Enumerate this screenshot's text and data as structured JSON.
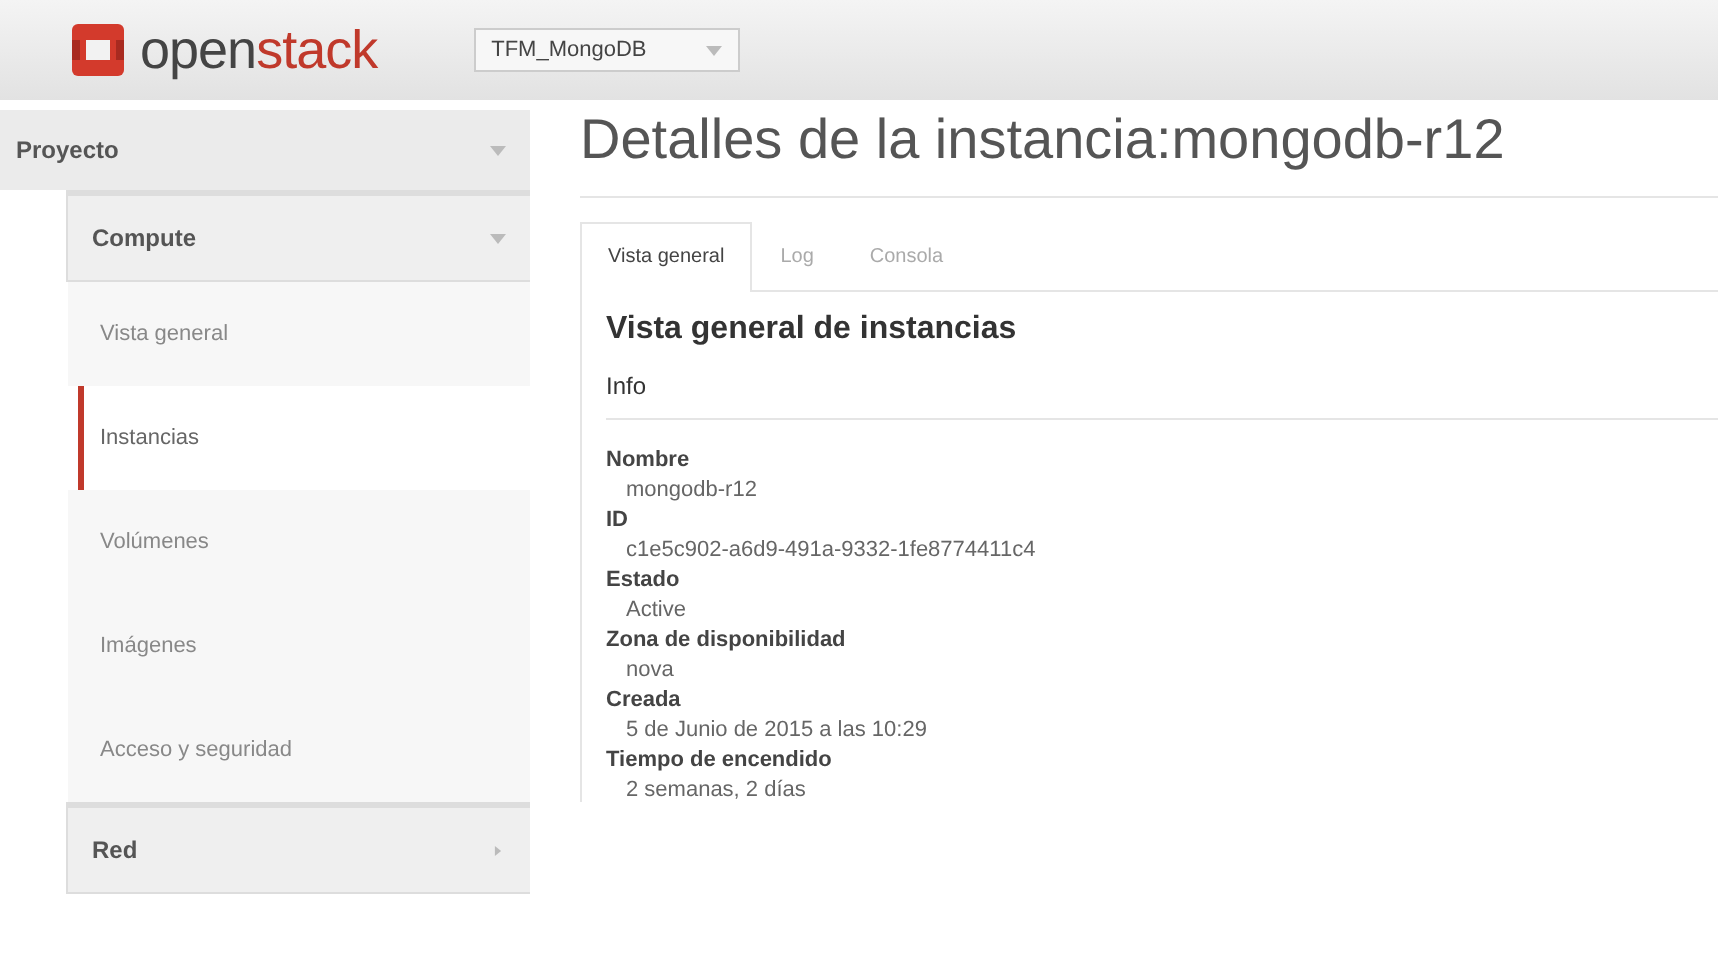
{
  "header": {
    "logo": {
      "part_1": "open",
      "part_2": "stack"
    },
    "project_selector": {
      "value": "TFM_MongoDB"
    }
  },
  "sidebar": {
    "title": "Proyecto",
    "expanded": true,
    "groups": [
      {
        "label": "Compute",
        "expanded": true,
        "items": [
          {
            "label": "Vista general",
            "selected": false
          },
          {
            "label": "Instancias",
            "selected": true
          },
          {
            "label": "Volúmenes",
            "selected": false
          },
          {
            "label": "Imágenes",
            "selected": false
          },
          {
            "label": "Acceso y seguridad",
            "selected": false
          }
        ]
      },
      {
        "label": "Red",
        "expanded": false
      }
    ]
  },
  "page_title": "Detalles de la instancia:mongodb-r12",
  "tabs": [
    {
      "label": "Vista general",
      "selected": true
    },
    {
      "label": "Log",
      "selected": false
    },
    {
      "label": "Consola",
      "selected": false
    }
  ],
  "section_title": "Vista general de instancias",
  "subsection_title": "Info",
  "fields": [
    {
      "label": "Nombre",
      "value": "mongodb-r12"
    },
    {
      "label": "ID",
      "value": "c1e5c902-a6d9-491a-9332-1fe8774411c4"
    },
    {
      "label": "Estado",
      "value": "Active"
    },
    {
      "label": "Zona de disponibilidad",
      "value": "nova"
    },
    {
      "label": "Creada",
      "value": "5 de Junio de 2015 a las 10:29"
    },
    {
      "label": "Tiempo de encendido",
      "value": "2 semanas, 2 días"
    }
  ]
}
